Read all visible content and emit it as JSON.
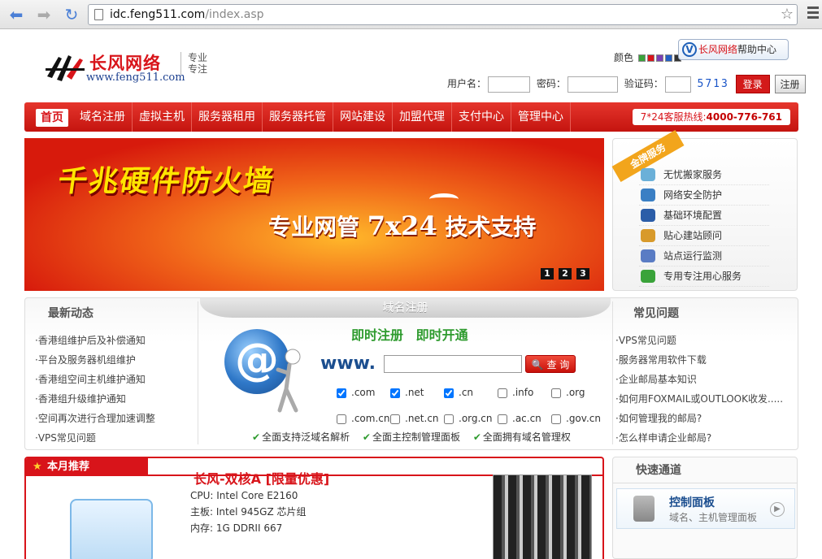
{
  "browser": {
    "url_host": "idc.feng511.com",
    "url_path": "/index.asp"
  },
  "header": {
    "logo_cn": "长风网络",
    "logo_en": "www.feng511.com",
    "slogan_1": "专业",
    "slogan_2": "专注",
    "colors_label": "颜色",
    "color_swatches": [
      "#3aa33a",
      "#d8141a",
      "#7b3fb5",
      "#2360c4",
      "#333333"
    ],
    "help_brand": "长风网络",
    "help_text": "帮助中心",
    "username_label": "用户名：",
    "password_label": "密码：",
    "captcha_label": "验证码：",
    "captcha_value": "5713",
    "login_button": "登录",
    "register_button": "注册"
  },
  "nav": {
    "items": [
      "首页",
      "域名注册",
      "虚拟主机",
      "服务器租用",
      "服务器托管",
      "网站建设",
      "加盟代理",
      "支付中心",
      "管理中心"
    ],
    "hotline_label": "7*24客服热线:",
    "hotline_number": "4000-776-761"
  },
  "banner": {
    "headline": "千兆硬件防火墙",
    "sub_prefix": "专业网管",
    "sub_mid": "7x24",
    "sub_suffix": "技术支持",
    "pages": [
      "1",
      "2",
      "3"
    ]
  },
  "gold": {
    "ribbon": "金牌服务",
    "items": [
      "无忧搬家服务",
      "网络安全防护",
      "基础环境配置",
      "贴心建站顾问",
      "站点运行监测",
      "专用专注用心服务"
    ]
  },
  "news": {
    "title": "最新动态",
    "items": [
      "·香港组维护后及补偿通知",
      "·平台及服务器机组维护",
      "·香港组空间主机维护通知",
      "·香港组升级维护通知",
      "·空间再次进行合理加速调整",
      "·VPS常见问题"
    ]
  },
  "domain": {
    "tab": "域名注册",
    "slogan": "即时注册 即时开通",
    "www": "www.",
    "query_button": "查 询",
    "tlds": [
      {
        "label": ".com",
        "checked": true
      },
      {
        "label": ".net",
        "checked": true
      },
      {
        "label": ".cn",
        "checked": true
      },
      {
        "label": ".info",
        "checked": false
      },
      {
        "label": ".org",
        "checked": false
      },
      {
        "label": ".com.cn",
        "checked": false
      },
      {
        "label": ".net.cn",
        "checked": false
      },
      {
        "label": ".org.cn",
        "checked": false
      },
      {
        "label": ".ac.cn",
        "checked": false
      },
      {
        "label": ".gov.cn",
        "checked": false
      }
    ],
    "features": [
      "全面支持泛域名解析",
      "全面主控制管理面板",
      "全面拥有域名管理权"
    ]
  },
  "faq": {
    "title": "常见问题",
    "items": [
      "·VPS常见问题",
      "·服务器常用软件下载",
      "·企业邮局基本知识",
      "·如何用FOXMAIL或OUTLOOK收发.....",
      "·如何管理我的邮局?",
      "·怎么样申请企业邮局?"
    ]
  },
  "recommend": {
    "head": "本月推荐",
    "title": "长风-双核A [限量优惠]",
    "specs": [
      "CPU: Intel Core E2160",
      "主板: Intel 945GZ 芯片组",
      "内存: 1G DDRII 667"
    ]
  },
  "quick": {
    "title": "快速通道",
    "panel_title": "控制面板",
    "panel_desc": "域名、主机管理面板"
  }
}
